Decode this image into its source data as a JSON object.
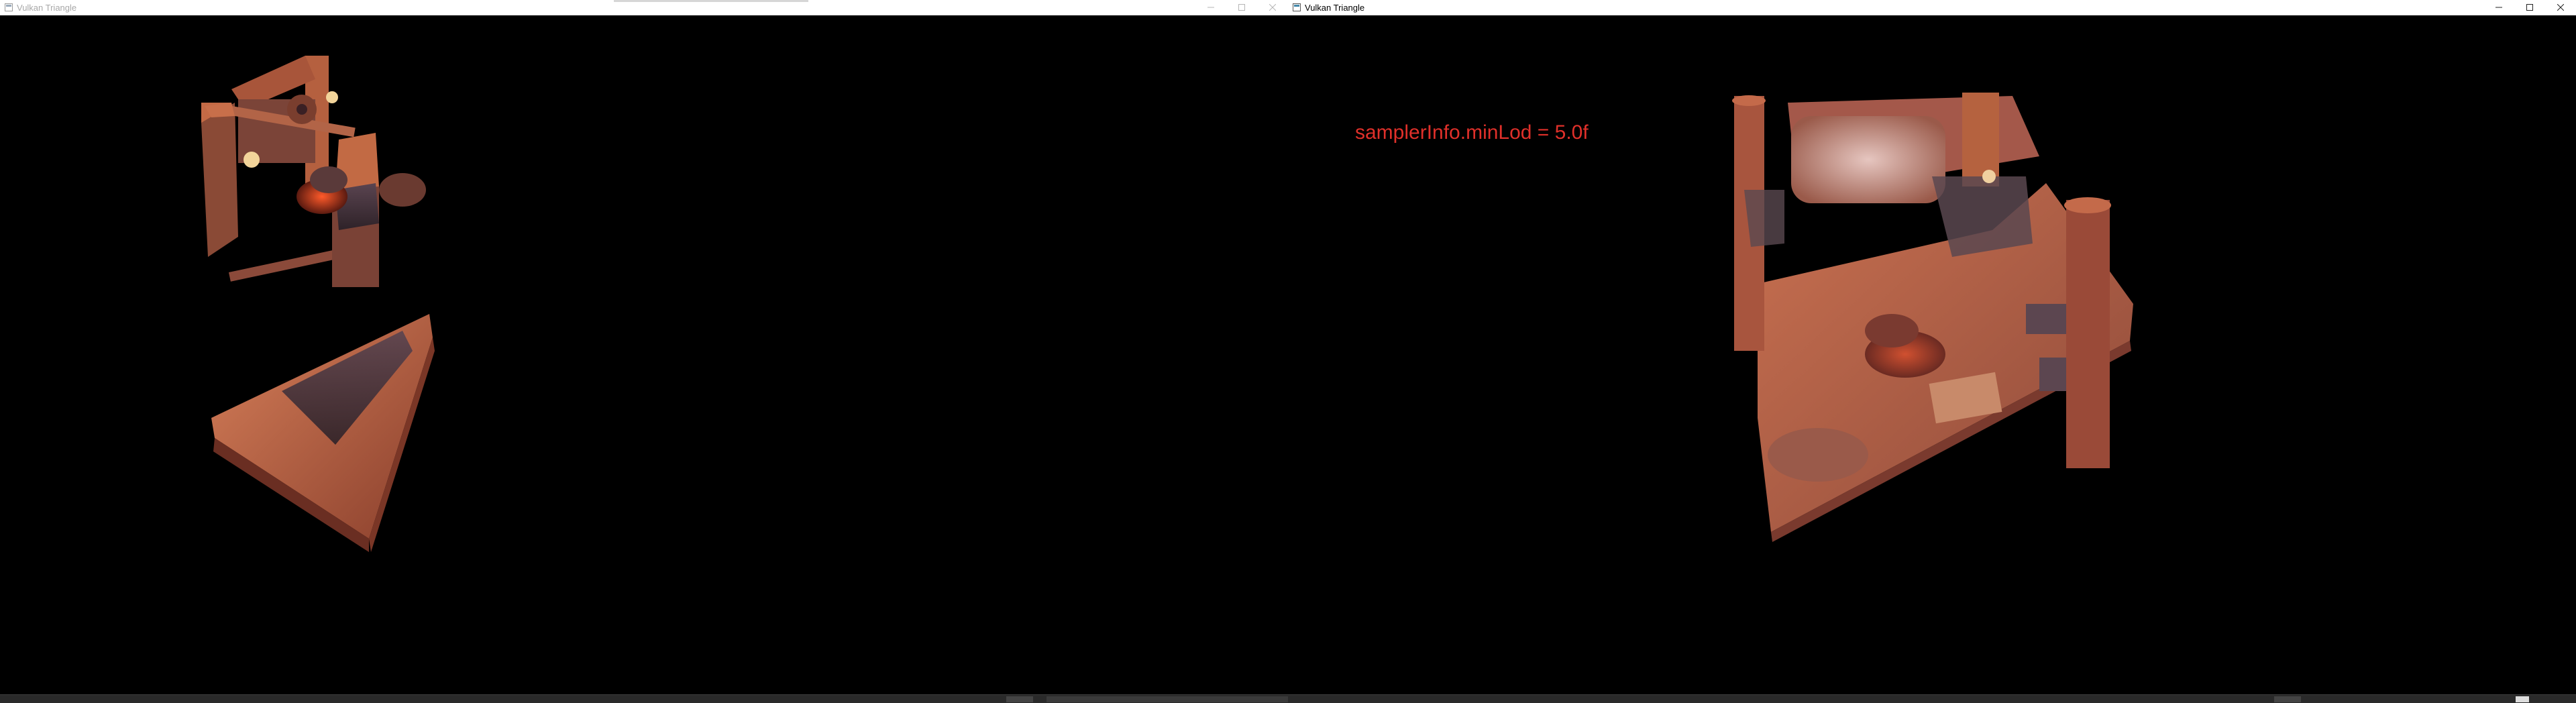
{
  "windows": [
    {
      "title": "Vulkan Triangle",
      "active": false,
      "icon": "vulkan-app-icon",
      "controls": [
        "minimize-icon",
        "maximize-icon",
        "close-icon"
      ]
    },
    {
      "title": "Vulkan Triangle",
      "active": true,
      "icon": "vulkan-app-icon",
      "controls": [
        "minimize-icon",
        "maximize-icon",
        "close-icon"
      ],
      "overlay_text": "samplerInfo.minLod = 5.0f"
    }
  ],
  "colors": {
    "overlay_text": "#e0302a",
    "background": "#000000",
    "scene_wood": "#b35a3a",
    "scene_dark": "#3a2a30"
  }
}
